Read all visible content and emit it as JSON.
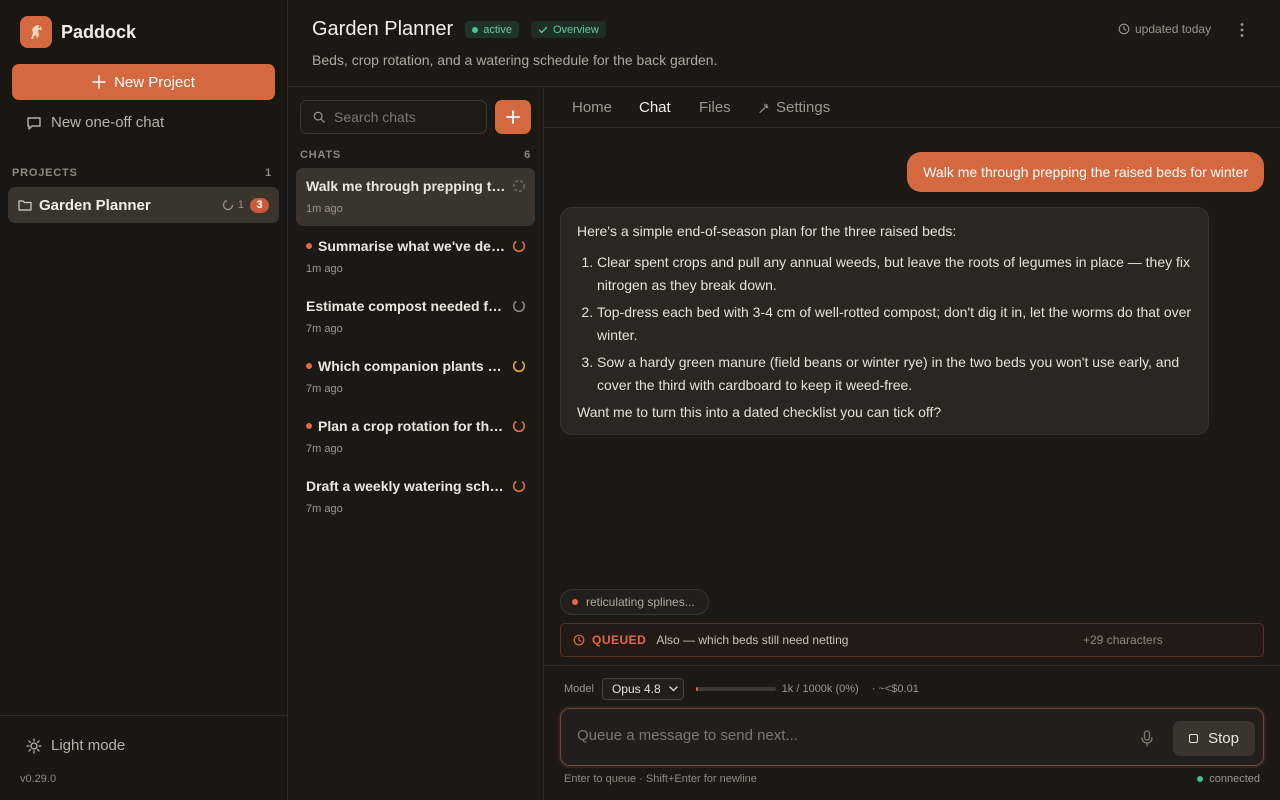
{
  "app": {
    "name": "Paddock",
    "version": "v0.29.0"
  },
  "colors": {
    "accent": "#d4683f",
    "success": "#4fc48c",
    "warning": "#e0a93a"
  },
  "sidebar": {
    "new_project_label": "New Project",
    "one_off_label": "New one-off chat",
    "projects_heading": "PROJECTS",
    "projects_count": "1",
    "projects": [
      {
        "name": "Garden Planner",
        "running": "1",
        "unread": "3",
        "icon": "folder-icon"
      }
    ],
    "light_mode_label": "Light mode"
  },
  "header": {
    "title": "Garden Planner",
    "status_badge": "active",
    "overview_badge": "Overview",
    "subtitle": "Beds, crop rotation, and a watering schedule for the back garden.",
    "updated": "updated today"
  },
  "chatlist": {
    "search_placeholder": "Search chats",
    "heading": "CHATS",
    "count": "6",
    "items": [
      {
        "title": "Walk me through prepping the raised beds for winter",
        "time": "1m ago",
        "unread": false,
        "status": "loading"
      },
      {
        "title": "Summarise what we've decided so far",
        "time": "1m ago",
        "unread": true,
        "status": "accent"
      },
      {
        "title": "Estimate compost needed for the beds",
        "time": "7m ago",
        "unread": false,
        "status": "idle"
      },
      {
        "title": "Which companion plants work together",
        "time": "7m ago",
        "unread": true,
        "status": "warning"
      },
      {
        "title": "Plan a crop rotation for the next three years",
        "time": "7m ago",
        "unread": true,
        "status": "accent"
      },
      {
        "title": "Draft a weekly watering schedule",
        "time": "7m ago",
        "unread": false,
        "status": "accent"
      }
    ]
  },
  "tabs": {
    "home": "Home",
    "chat": "Chat",
    "files": "Files",
    "settings": "Settings",
    "active": "chat"
  },
  "conversation": {
    "user_message": "Walk me through prepping the raised beds for winter",
    "assistant": {
      "intro": "Here's a simple end-of-season plan for the three raised beds:",
      "steps": [
        "Clear spent crops and pull any annual weeds, but leave the roots of legumes in place — they fix nitrogen as they break down.",
        "Top-dress each bed with 3-4 cm of well-rotted compost; don't dig it in, let the worms do that over winter.",
        "Sow a hardy green manure (field beans or winter rye) in the two beds you won't use early, and cover the third with cardboard to keep it weed-free."
      ],
      "outro": "Want me to turn this into a dated checklist you can tick off?"
    },
    "status_text": "reticulating splines..."
  },
  "queue": {
    "label": "QUEUED",
    "text": "Also — which beds still need netting",
    "extra": "+29 characters"
  },
  "composer": {
    "model_label": "Model",
    "model_value": "Opus 4.8",
    "context_used_fraction": 0.01,
    "tokens": "1k / 1000k (0%)",
    "cost": "· ~<$0.01",
    "placeholder": "Queue a message to send next...",
    "stop_label": "Stop",
    "hint": "Enter to queue · Shift+Enter for newline",
    "connection": "connected"
  }
}
